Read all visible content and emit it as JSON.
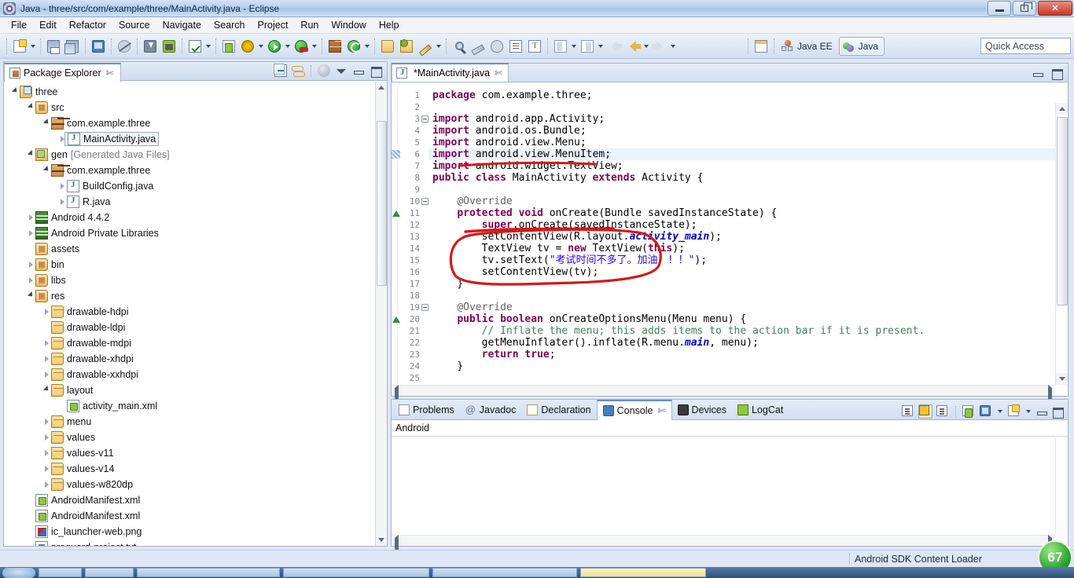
{
  "window": {
    "title": "Java - three/src/com/example/three/MainActivity.java - Eclipse",
    "app_icon": "eclipse-icon",
    "minimize_label": "Minimize",
    "maximize_label": "Maximize",
    "close_label": "Close"
  },
  "menubar": {
    "items": [
      "File",
      "Edit",
      "Refactor",
      "Source",
      "Navigate",
      "Search",
      "Project",
      "Run",
      "Window",
      "Help"
    ]
  },
  "toolbar": {
    "buttons": [
      {
        "name": "new-button",
        "icon": "new-document-icon",
        "dropdown": true
      },
      {
        "name": "save-button",
        "icon": "save-icon",
        "dropdown": false
      },
      {
        "name": "save-all-button",
        "icon": "save-all-icon",
        "dropdown": false
      },
      {
        "name": "print-button",
        "icon": "print-icon",
        "dropdown": false
      },
      {
        "name": "toggle-markers-button",
        "icon": "no-warnings-icon",
        "dropdown": false
      },
      {
        "name": "android-sdk-manager-button",
        "icon": "android-download-icon",
        "dropdown": false
      },
      {
        "name": "android-avd-manager-button",
        "icon": "android-device-icon",
        "dropdown": false
      },
      {
        "name": "validate-button",
        "icon": "checkmark-icon",
        "dropdown": true
      },
      {
        "name": "new-android-project-button",
        "icon": "new-android-icon",
        "dropdown": false
      },
      {
        "name": "debug-button",
        "icon": "bug-icon",
        "dropdown": true
      },
      {
        "name": "run-button",
        "icon": "run-icon",
        "dropdown": true
      },
      {
        "name": "run-configurations-button",
        "icon": "run-config-icon",
        "dropdown": true
      },
      {
        "name": "coverage-button",
        "icon": "grid-icon",
        "dropdown": false
      },
      {
        "name": "external-tools-button",
        "icon": "refresh-icon",
        "dropdown": true
      },
      {
        "name": "open-type-button",
        "icon": "open-folder-icon",
        "dropdown": false
      },
      {
        "name": "open-resource-button",
        "icon": "open-folder-green-icon",
        "dropdown": false
      },
      {
        "name": "highlight-button",
        "icon": "pencil-icon",
        "dropdown": true
      },
      {
        "name": "search-button",
        "icon": "search-icon",
        "dropdown": false
      },
      {
        "name": "clean-button",
        "icon": "brush-icon",
        "dropdown": false
      },
      {
        "name": "hide-fields-button",
        "icon": "mask-icon",
        "dropdown": false
      },
      {
        "name": "show-source-button",
        "icon": "document-icon",
        "dropdown": false
      },
      {
        "name": "show-whitespace-button",
        "icon": "paragraph-icon",
        "dropdown": false
      },
      {
        "name": "next-annotation-button",
        "icon": "next-edit-icon",
        "dropdown": true
      },
      {
        "name": "previous-annotation-button",
        "icon": "previous-edit-icon",
        "dropdown": true
      },
      {
        "name": "last-edit-location-button",
        "icon": "last-edit-arrow-icon",
        "dropdown": false
      },
      {
        "name": "back-button",
        "icon": "arrow-left-icon",
        "dropdown": true
      },
      {
        "name": "forward-button",
        "icon": "arrow-right-icon",
        "dropdown": true
      },
      {
        "name": "open-perspective-button",
        "icon": "open-perspective-icon",
        "dropdown": false
      }
    ]
  },
  "perspectives": {
    "items": [
      {
        "label": "Java EE",
        "active": false,
        "icon": "java-ee-perspective-icon"
      },
      {
        "label": "Java",
        "active": true,
        "icon": "java-perspective-icon"
      }
    ]
  },
  "quick_access": {
    "placeholder": "Quick Access",
    "value": "Quick Access"
  },
  "package_explorer": {
    "tab_label": "Package Explorer",
    "tab_icon": "package-explorer-icon",
    "close_icon": "close-icon",
    "tools": [
      "collapse-all-icon",
      "link-with-editor-icon",
      "view-menu-icon",
      "view-dropdown-icon",
      "minimize-icon",
      "maximize-icon"
    ],
    "tree": [
      {
        "label": "three",
        "indent": 0,
        "twisty": "expanded",
        "icon": "project-icon",
        "selected": false
      },
      {
        "label": "src",
        "indent": 1,
        "twisty": "expanded",
        "icon": "source-folder-icon",
        "selected": false
      },
      {
        "label": "com.example.three",
        "indent": 2,
        "twisty": "expanded",
        "icon": "package-icon",
        "selected": false
      },
      {
        "label": "MainActivity.java",
        "indent": 3,
        "twisty": "collapsed",
        "icon": "java-file-icon",
        "selected": true
      },
      {
        "label": "gen",
        "suffix": "[Generated Java Files]",
        "indent": 1,
        "twisty": "expanded",
        "icon": "gen-folder-icon",
        "selected": false
      },
      {
        "label": "com.example.three",
        "indent": 2,
        "twisty": "expanded",
        "icon": "package-icon",
        "selected": false
      },
      {
        "label": "BuildConfig.java",
        "indent": 3,
        "twisty": "collapsed",
        "icon": "java-file-icon",
        "selected": false
      },
      {
        "label": "R.java",
        "indent": 3,
        "twisty": "collapsed",
        "icon": "java-file-icon",
        "selected": false
      },
      {
        "label": "Android 4.4.2",
        "indent": 1,
        "twisty": "collapsed",
        "icon": "library-icon",
        "selected": false
      },
      {
        "label": "Android Private Libraries",
        "indent": 1,
        "twisty": "collapsed",
        "icon": "library-icon",
        "selected": false
      },
      {
        "label": "assets",
        "indent": 1,
        "twisty": "none",
        "icon": "source-folder-icon",
        "selected": false
      },
      {
        "label": "bin",
        "indent": 1,
        "twisty": "collapsed",
        "icon": "source-folder-icon",
        "selected": false
      },
      {
        "label": "libs",
        "indent": 1,
        "twisty": "collapsed",
        "icon": "source-folder-icon",
        "selected": false
      },
      {
        "label": "res",
        "indent": 1,
        "twisty": "expanded",
        "icon": "source-folder-icon",
        "selected": false
      },
      {
        "label": "drawable-hdpi",
        "indent": 2,
        "twisty": "collapsed",
        "icon": "folder-icon",
        "selected": false
      },
      {
        "label": "drawable-ldpi",
        "indent": 2,
        "twisty": "none",
        "icon": "folder-icon",
        "selected": false
      },
      {
        "label": "drawable-mdpi",
        "indent": 2,
        "twisty": "collapsed",
        "icon": "folder-icon",
        "selected": false
      },
      {
        "label": "drawable-xhdpi",
        "indent": 2,
        "twisty": "collapsed",
        "icon": "folder-icon",
        "selected": false
      },
      {
        "label": "drawable-xxhdpi",
        "indent": 2,
        "twisty": "collapsed",
        "icon": "folder-icon",
        "selected": false
      },
      {
        "label": "layout",
        "indent": 2,
        "twisty": "expanded",
        "icon": "folder-icon",
        "selected": false
      },
      {
        "label": "activity_main.xml",
        "indent": 3,
        "twisty": "none",
        "icon": "xml-file-icon",
        "selected": false
      },
      {
        "label": "menu",
        "indent": 2,
        "twisty": "collapsed",
        "icon": "folder-icon",
        "selected": false
      },
      {
        "label": "values",
        "indent": 2,
        "twisty": "collapsed",
        "icon": "folder-icon",
        "selected": false
      },
      {
        "label": "values-v11",
        "indent": 2,
        "twisty": "collapsed",
        "icon": "folder-icon",
        "selected": false
      },
      {
        "label": "values-v14",
        "indent": 2,
        "twisty": "collapsed",
        "icon": "folder-icon",
        "selected": false
      },
      {
        "label": "values-w820dp",
        "indent": 2,
        "twisty": "collapsed",
        "icon": "folder-icon",
        "selected": false
      },
      {
        "label": "AndroidManifest.xml",
        "indent": 1,
        "twisty": "none",
        "icon": "xml-file-icon",
        "selected": false
      },
      {
        "label": "AndroidManifest.xml",
        "indent": 1,
        "twisty": "none",
        "icon": "xml-file-icon",
        "selected": false
      },
      {
        "label": "ic_launcher-web.png",
        "indent": 1,
        "twisty": "none",
        "icon": "png-file-icon",
        "selected": false
      },
      {
        "label": "proguard-project.txt",
        "indent": 1,
        "twisty": "none",
        "icon": "text-file-icon",
        "selected": false
      }
    ]
  },
  "editor": {
    "tab_label": "*MainActivity.java",
    "tab_icon": "java-file-icon",
    "close_icon": "close-icon",
    "minimize_icon": "minimize-icon",
    "maximize_icon": "maximize-icon",
    "highlighted_line": 6,
    "lines": [
      {
        "n": 1,
        "fold": false,
        "mark": "",
        "html": "<span class=\"kw\">package</span> com.example.three;"
      },
      {
        "n": 2,
        "fold": false,
        "mark": "",
        "html": ""
      },
      {
        "n": 3,
        "fold": true,
        "mark": "",
        "html": "<span class=\"kw\">import</span> android.app.Activity;"
      },
      {
        "n": 4,
        "fold": false,
        "mark": "",
        "html": "<span class=\"kw\">import</span> android.os.Bundle;"
      },
      {
        "n": 5,
        "fold": false,
        "mark": "",
        "html": "<span class=\"kw\">import</span> android.view.Menu;"
      },
      {
        "n": 6,
        "fold": false,
        "mark": "bookmark",
        "html": "<span class=\"kw\">import</span> android.view.MenuItem;"
      },
      {
        "n": 7,
        "fold": false,
        "mark": "",
        "html": "<span class=\"kw\">import</span> android.widget.TextView;"
      },
      {
        "n": 8,
        "fold": false,
        "mark": "",
        "html": "<span class=\"kw\">public class</span> MainActivity <span class=\"kw\">extends</span> Activity {"
      },
      {
        "n": 9,
        "fold": false,
        "mark": "",
        "html": ""
      },
      {
        "n": 10,
        "fold": true,
        "mark": "",
        "html": "    <span class=\"ann\">@Override</span>"
      },
      {
        "n": 11,
        "fold": false,
        "mark": "override",
        "html": "    <span class=\"kw\">protected void</span> onCreate(Bundle savedInstanceState) {"
      },
      {
        "n": 12,
        "fold": false,
        "mark": "",
        "html": "        <span class=\"kw\">super</span>.onCreate(savedInstanceState);"
      },
      {
        "n": 13,
        "fold": false,
        "mark": "",
        "html": "        setContentView(R.layout.<span class=\"fld\">activity_main</span>);"
      },
      {
        "n": 14,
        "fold": false,
        "mark": "",
        "html": "        TextView tv = <span class=\"kw\">new</span> TextView(<span class=\"kw\">this</span>);"
      },
      {
        "n": 15,
        "fold": false,
        "mark": "",
        "html": "        tv.setText(<span class=\"str\">\"考试时间不多了。加油！！！\"</span>);"
      },
      {
        "n": 16,
        "fold": false,
        "mark": "",
        "html": "        setContentView(tv);"
      },
      {
        "n": 17,
        "fold": false,
        "mark": "",
        "html": "    }"
      },
      {
        "n": 18,
        "fold": false,
        "mark": "",
        "html": ""
      },
      {
        "n": 19,
        "fold": true,
        "mark": "",
        "html": "    <span class=\"ann\">@Override</span>"
      },
      {
        "n": 20,
        "fold": false,
        "mark": "override",
        "html": "    <span class=\"kw\">public boolean</span> onCreateOptionsMenu(Menu menu) {"
      },
      {
        "n": 21,
        "fold": false,
        "mark": "",
        "html": "        <span class=\"cmt\">// Inflate the menu; this adds items to the action bar if it is present.</span>"
      },
      {
        "n": 22,
        "fold": false,
        "mark": "",
        "html": "        getMenuInflater().inflate(R.menu.<span class=\"fld\">main</span>, menu);"
      },
      {
        "n": 23,
        "fold": false,
        "mark": "",
        "html": "        <span class=\"kw\">return true</span>;"
      },
      {
        "n": 24,
        "fold": false,
        "mark": "",
        "html": "    }"
      },
      {
        "n": 25,
        "fold": false,
        "mark": "",
        "html": ""
      }
    ],
    "annotations": [
      {
        "name": "red-underline-annotation",
        "shape": "underline",
        "target_line": 7
      },
      {
        "name": "red-strike-annotation",
        "shape": "strike",
        "target_line": 13
      },
      {
        "name": "red-ellipse-annotation",
        "shape": "ellipse",
        "target_lines": "14-16"
      }
    ]
  },
  "bottom_panel": {
    "tabs": [
      {
        "label": "Problems",
        "icon": "problems-icon",
        "active": false
      },
      {
        "label": "Javadoc",
        "icon": "javadoc-icon",
        "active": false
      },
      {
        "label": "Declaration",
        "icon": "declaration-icon",
        "active": false
      },
      {
        "label": "Console",
        "icon": "console-icon",
        "active": true
      },
      {
        "label": "Devices",
        "icon": "devices-icon",
        "active": false
      },
      {
        "label": "LogCat",
        "icon": "logcat-icon",
        "active": false
      }
    ],
    "close_icon": "close-icon",
    "console_name": "Android",
    "console_output": "",
    "tools": [
      {
        "name": "clear-console-button",
        "icon": "clear-console-icon",
        "pressed": false
      },
      {
        "name": "scroll-lock-button",
        "icon": "scroll-lock-icon",
        "pressed": true
      },
      {
        "name": "show-console-when-output-button",
        "icon": "show-on-output-icon",
        "pressed": false
      },
      {
        "name": "pin-console-button",
        "icon": "pin-console-icon",
        "pressed": false
      },
      {
        "name": "display-selected-console-button",
        "icon": "display-console-icon",
        "pressed": false
      },
      {
        "name": "open-console-button",
        "icon": "open-console-icon",
        "pressed": false
      },
      {
        "name": "minimize-panel-button",
        "icon": "minimize-icon",
        "pressed": false
      },
      {
        "name": "maximize-panel-button",
        "icon": "maximize-icon",
        "pressed": false
      }
    ]
  },
  "status_bar": {
    "message": "Android SDK Content Loader"
  },
  "overlay_badge": {
    "value": "67",
    "color": "#1f9a2e"
  },
  "colors": {
    "keyword": "#7f0055",
    "string": "#2a00ff",
    "comment": "#3f7f5f",
    "field": "#0000c0",
    "annotation_red": "#d41a1a",
    "highlight_row": "#eaf2fc",
    "accent": "#6b8fc0"
  }
}
